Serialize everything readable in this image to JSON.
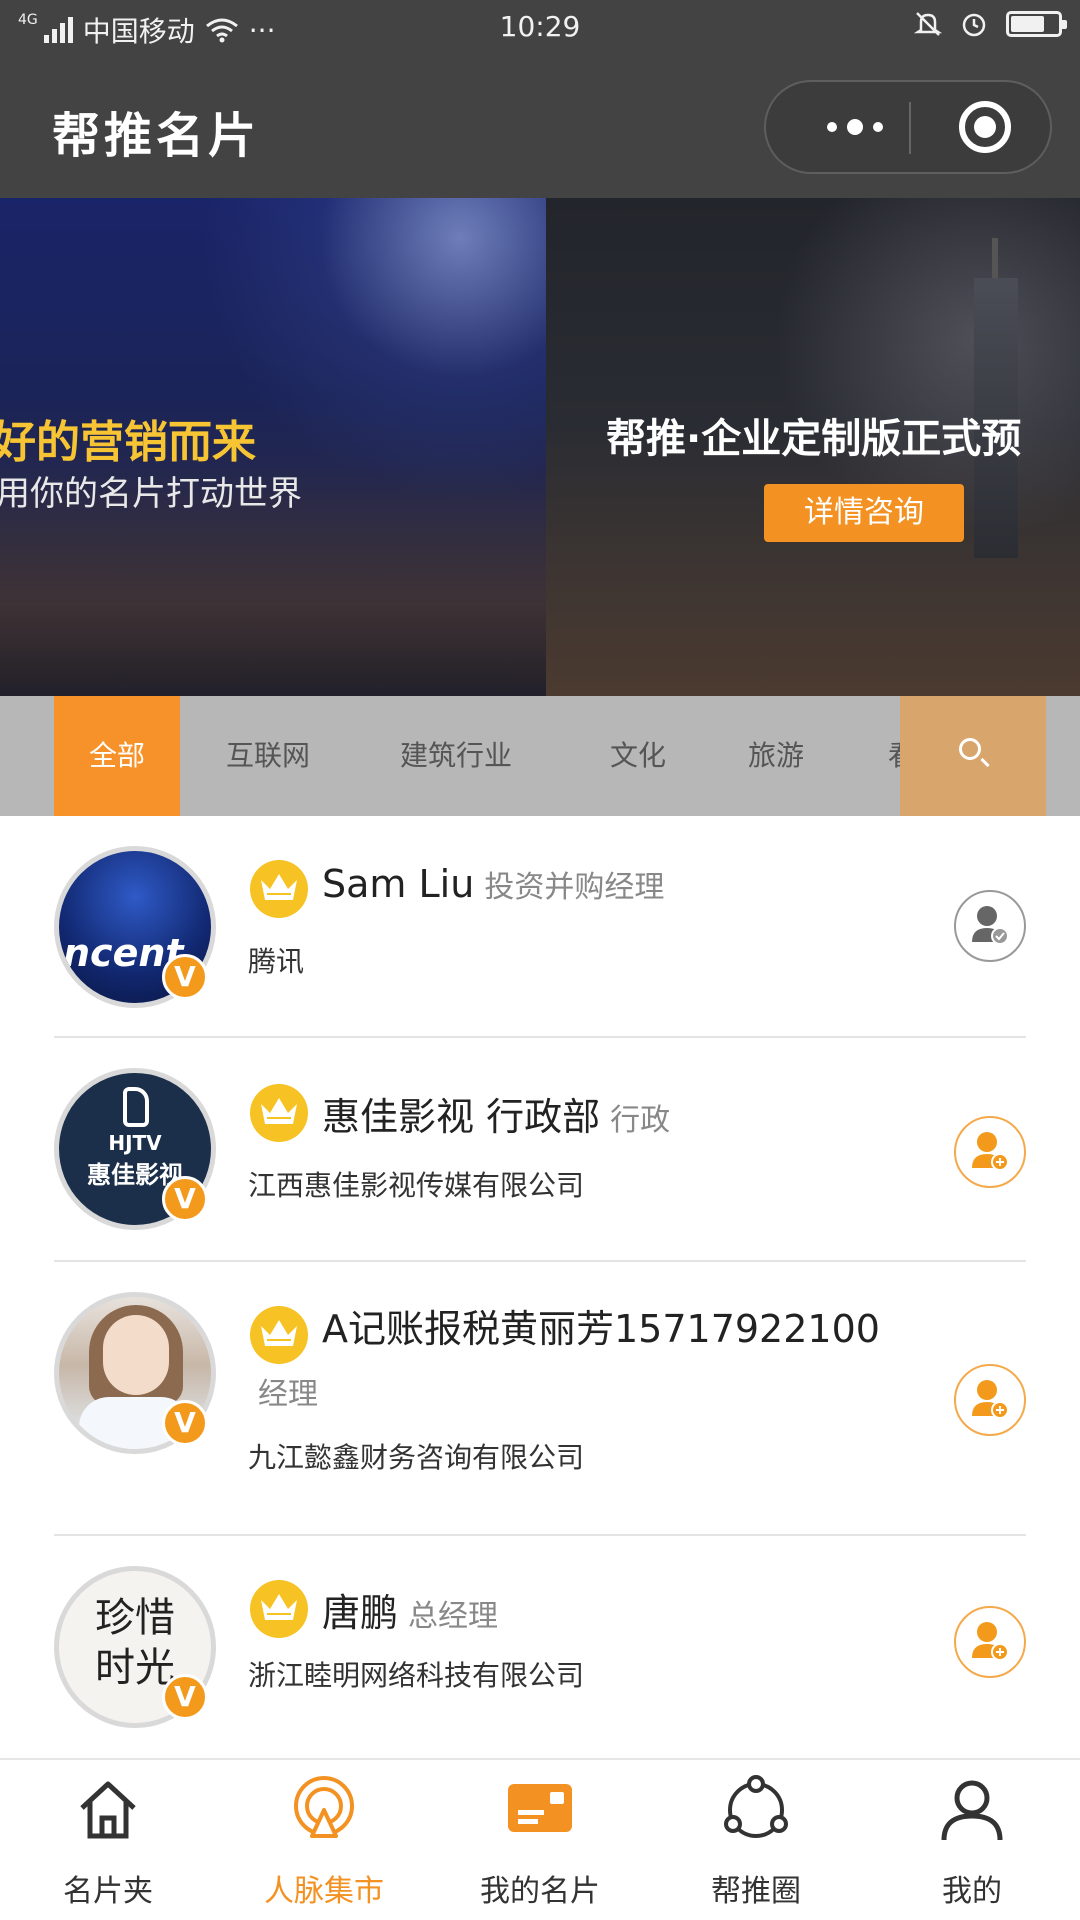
{
  "status_bar": {
    "network": "4G",
    "carrier": "中国移动",
    "extra": "···",
    "time": "10:29",
    "battery_level": 0.65
  },
  "title_bar": {
    "title": "帮推名片"
  },
  "banner": {
    "slide1_headline": "好的营销而来",
    "slide1_subline": "用你的名片打动世界",
    "slide2_headline": "帮推·企业定制版正式预",
    "slide2_button": "详情咨询"
  },
  "categories": {
    "items": [
      "全部",
      "互联网",
      "建筑行业",
      "文化",
      "旅游",
      "看"
    ],
    "active_index": 0
  },
  "contacts": [
    {
      "name": "Sam Liu",
      "role": "投资并购经理",
      "company": "腾讯",
      "verified": "V",
      "action": "added"
    },
    {
      "name": "惠佳影视 行政部",
      "role": "行政",
      "company": "江西惠佳影视传媒有限公司",
      "verified": "V",
      "action": "add",
      "avatar_line1": "HJTV",
      "avatar_line2": "惠佳影视"
    },
    {
      "name": "A记账报税黄丽芳15717922100",
      "role": "经理",
      "company": "九江懿鑫财务咨询有限公司",
      "verified": "V",
      "action": "add"
    },
    {
      "name": "唐鹏",
      "role": "总经理",
      "company": "浙江睦明网络科技有限公司",
      "verified": "V",
      "action": "add",
      "avatar_line1": "珍惜",
      "avatar_line2": "时光"
    }
  ],
  "tab_bar": {
    "items": [
      {
        "label": "名片夹",
        "icon": "home-icon"
      },
      {
        "label": "人脉集市",
        "icon": "broadcast-icon"
      },
      {
        "label": "我的名片",
        "icon": "card-icon"
      },
      {
        "label": "帮推圈",
        "icon": "share-circle-icon"
      },
      {
        "label": "我的",
        "icon": "user-icon"
      }
    ],
    "active_index": 1
  },
  "colors": {
    "accent": "#f39222",
    "header_bg": "#434343",
    "tabs_bg": "#b7b7b7",
    "crown": "#f6c224"
  }
}
